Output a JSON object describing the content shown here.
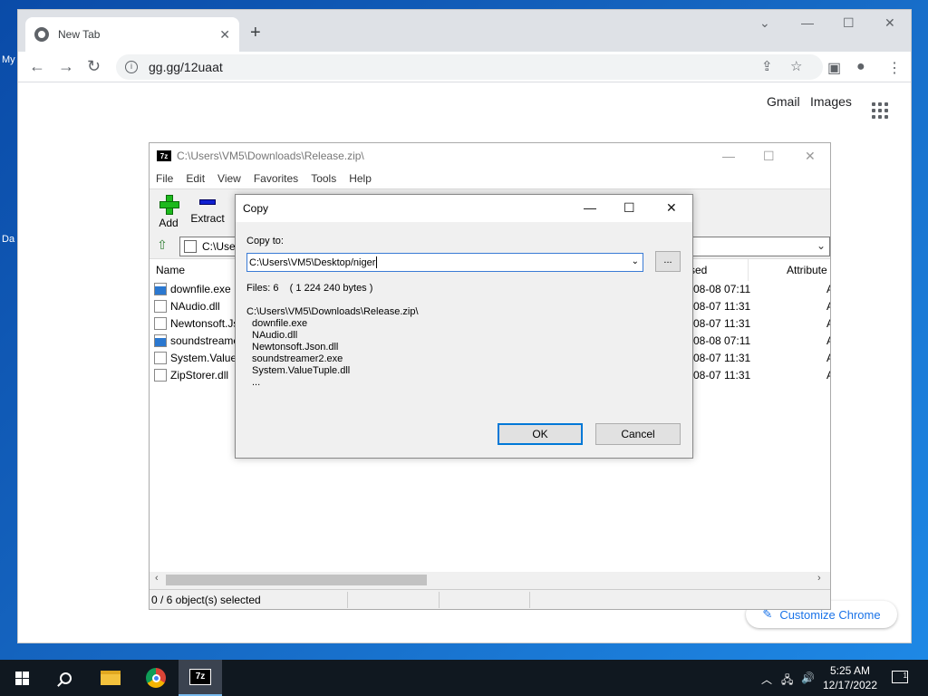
{
  "desktop": {
    "label_my": "My",
    "label_da": "Da"
  },
  "chrome": {
    "tab_title": "New Tab",
    "url": "gg.gg/12uaat",
    "gmail": "Gmail",
    "images": "Images",
    "customize": "Customize Chrome"
  },
  "sevenzip": {
    "title": "C:\\Users\\VM5\\Downloads\\Release.zip\\",
    "menu": [
      "File",
      "Edit",
      "View",
      "Favorites",
      "Tools",
      "Help"
    ],
    "toolbar": {
      "add": "Add",
      "extract": "Extract"
    },
    "address": "C:\\Users",
    "columns": {
      "name": "Name",
      "modified": "sed",
      "attributes": "Attribute"
    },
    "files": [
      {
        "name": "downfile.exe",
        "date": "08-08 07:11",
        "attr": "A"
      },
      {
        "name": "NAudio.dll",
        "date": "08-07 11:31",
        "attr": "A"
      },
      {
        "name": "Newtonsoft.Js",
        "date": "08-07 11:31",
        "attr": "A"
      },
      {
        "name": "soundstreame",
        "date": "08-08 07:11",
        "attr": "A"
      },
      {
        "name": "System.ValueT",
        "date": "08-07 11:31",
        "attr": "A"
      },
      {
        "name": "ZipStorer.dll",
        "date": "08-07 11:31",
        "attr": "A"
      }
    ],
    "status": "0 / 6 object(s) selected"
  },
  "dialog": {
    "title": "Copy",
    "copy_to_label": "Copy to:",
    "path": "C:\\Users\\VM5\\Desktop/niger",
    "browse": "...",
    "files_info": "Files: 6    ( 1 224 240 bytes )",
    "source": "C:\\Users\\VM5\\Downloads\\Release.zip\\",
    "items": [
      "downfile.exe",
      "NAudio.dll",
      "Newtonsoft.Json.dll",
      "soundstreamer2.exe",
      "System.ValueTuple.dll",
      "..."
    ],
    "ok": "OK",
    "cancel": "Cancel"
  },
  "taskbar": {
    "time": "5:25 AM",
    "date": "12/17/2022",
    "notifications": "1",
    "sevenzip_label": "7z"
  }
}
